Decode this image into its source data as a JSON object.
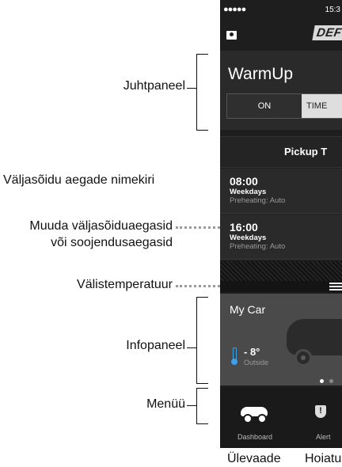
{
  "annotations": {
    "juhtpaneel": "Juhtpaneel",
    "departure_list": "Väljasõidu aegade nimekiri",
    "edit_line1": "Muuda väljasõiduaegasid",
    "edit_line2": "või soojendusaegasid",
    "outside_temp": "Välistemperatuur",
    "infopanel": "Infopaneel",
    "menu": "Menüü",
    "overview": "Ülevaade",
    "alerts": "Hoiatu"
  },
  "status_bar": {
    "signal": "●●●●●",
    "time": "15:3"
  },
  "nav": {
    "brand": "DEF"
  },
  "dashboard": {
    "title": "WarmUp",
    "on_label": "ON",
    "timer_label": "TIME"
  },
  "pickup": {
    "header": "Pickup T",
    "items": [
      {
        "time": "08:00",
        "days": "Weekdays",
        "preheat": "Preheating: Auto"
      },
      {
        "time": "16:00",
        "days": "Weekdays",
        "preheat": "Preheating: Auto"
      }
    ]
  },
  "info": {
    "car_name": "My Car",
    "temperature": "- 8°",
    "temp_caption": "Outside"
  },
  "menu": {
    "items": [
      {
        "label": "Dashboard",
        "icon": "car-icon"
      },
      {
        "label": "Alert",
        "icon": "shield-icon"
      }
    ]
  },
  "colors": {
    "phone_bg": "#1e1e1e",
    "timer_active": "#dedede",
    "thermometer": "#3aa0e8"
  }
}
